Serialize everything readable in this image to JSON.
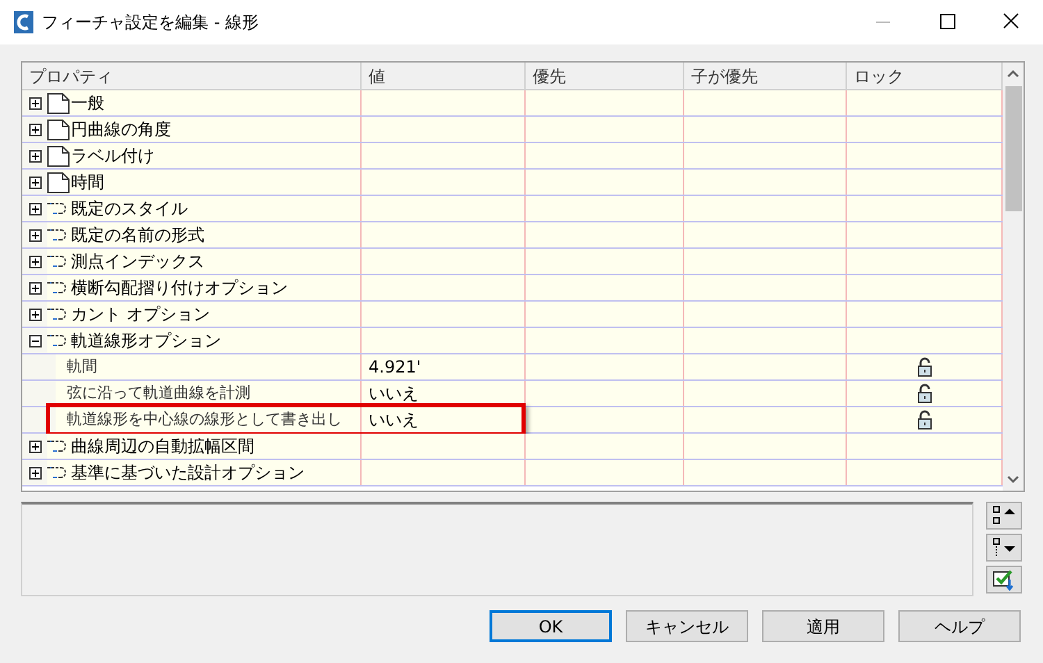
{
  "window": {
    "title": "フィーチャ設定を編集 - 線形"
  },
  "table": {
    "columns": [
      "プロパティ",
      "値",
      "優先",
      "子が優先",
      "ロック"
    ],
    "rows": [
      {
        "label": "一般",
        "kind": "page",
        "expanded": false
      },
      {
        "label": "円曲線の角度",
        "kind": "page",
        "expanded": false
      },
      {
        "label": "ラベル付け",
        "kind": "page",
        "expanded": false
      },
      {
        "label": "時間",
        "kind": "page",
        "expanded": false
      },
      {
        "label": "既定のスタイル",
        "kind": "link",
        "expanded": false
      },
      {
        "label": "既定の名前の形式",
        "kind": "link",
        "expanded": false
      },
      {
        "label": "測点インデックス",
        "kind": "link",
        "expanded": false
      },
      {
        "label": "横断勾配摺り付けオプション",
        "kind": "link",
        "expanded": false
      },
      {
        "label": "カント オプション",
        "kind": "link",
        "expanded": false
      },
      {
        "label": "軌道線形オプション",
        "kind": "link",
        "expanded": true,
        "children": [
          {
            "label": "軌間",
            "value": "4.921'",
            "locked": false,
            "highlighted": false
          },
          {
            "label": "弦に沿って軌道曲線を計測",
            "value": "いいえ",
            "locked": false,
            "highlighted": false
          },
          {
            "label": "軌道線形を中心線の線形として書き出し",
            "value": "いいえ",
            "locked": false,
            "highlighted": true
          }
        ]
      },
      {
        "label": "曲線周辺の自動拡幅区間",
        "kind": "link",
        "expanded": false
      },
      {
        "label": "基準に基づいた設計オプション",
        "kind": "link",
        "expanded": false
      }
    ]
  },
  "buttons": [
    {
      "label": "OK",
      "default": true
    },
    {
      "label": "キャンセル",
      "default": false
    },
    {
      "label": "適用",
      "default": false
    },
    {
      "label": "ヘルプ",
      "default": false
    }
  ]
}
